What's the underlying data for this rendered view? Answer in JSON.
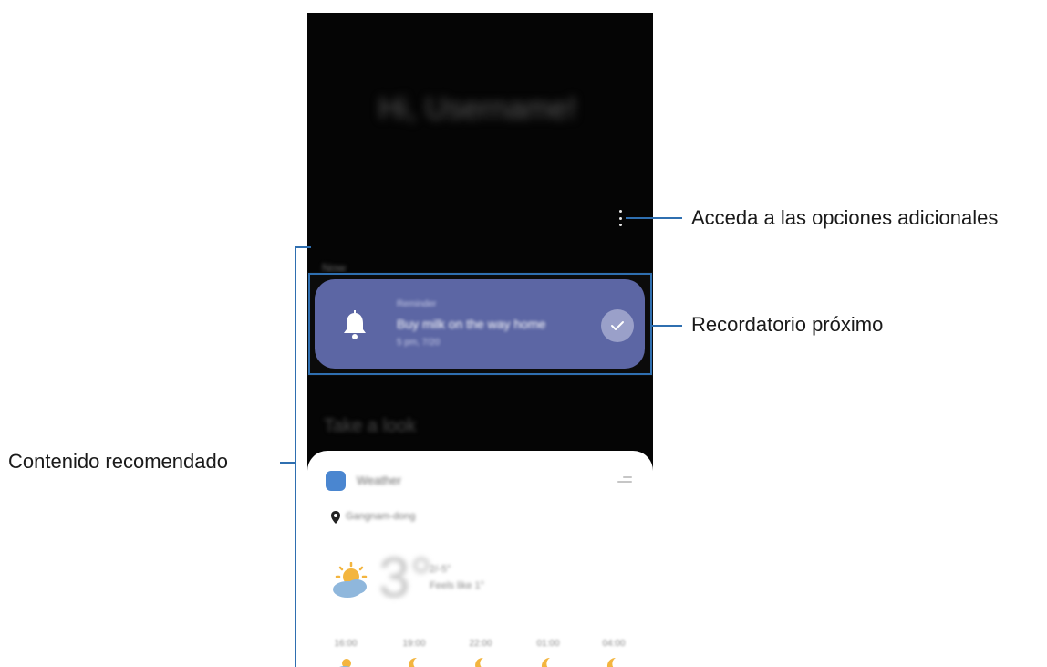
{
  "annotations": {
    "more_options": "Acceda a las opciones adicionales",
    "upcoming_reminder": "Recordatorio próximo",
    "recommended_content": "Contenido recomendado"
  },
  "screen": {
    "greeting": "Hi, Username!",
    "section_label": "Now",
    "reminder": {
      "app": "Reminder",
      "title": "Buy milk on the way home",
      "time": "5 pm, 7/20"
    },
    "take_a_look": "Take a look",
    "weather": {
      "title": "Weather",
      "location": "Gangnam-dong",
      "temperature": "3°",
      "meta_line1": "2/-5°",
      "meta_line2": "Feels like 1°",
      "hours": [
        "16:00",
        "19:00",
        "22:00",
        "01:00",
        "04:00"
      ]
    }
  },
  "colors": {
    "reminder_card": "#5c66a4",
    "annotation_line": "#2f6fb0",
    "phone_bg": "#050505"
  }
}
